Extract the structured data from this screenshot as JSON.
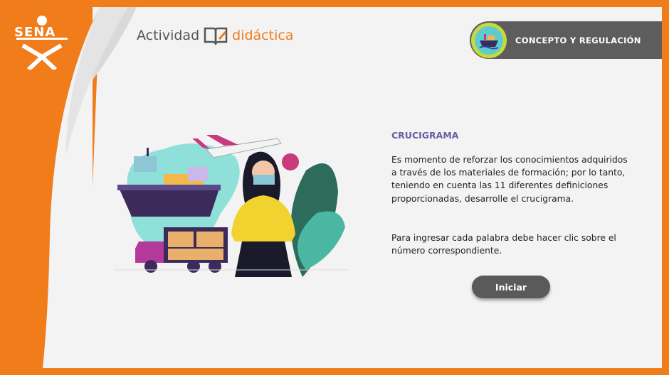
{
  "brand": {
    "logo_text": "SENA"
  },
  "header": {
    "activity_word1": "Actividad",
    "activity_word2": "didáctica",
    "badge_label": "CONCEPTO Y REGULACIÓN",
    "badge_icon": "ship-icon"
  },
  "main": {
    "title": "CRUCIGRAMA",
    "paragraph1": "Es momento de reforzar los conocimientos adquiridos a través de los materiales de formación; por lo tanto, teniendo en cuenta las 11 diferentes definiciones proporcionadas, desarrolle el crucigrama.",
    "paragraph2": "Para ingresar cada palabra debe hacer clic sobre el número correspondiente.",
    "start_button": "Iniciar"
  },
  "colors": {
    "brand_orange": "#f07c1a",
    "title_purple": "#6b5aa6",
    "badge_gray": "#5d5d5d",
    "button_gray": "#5a5a5a"
  }
}
